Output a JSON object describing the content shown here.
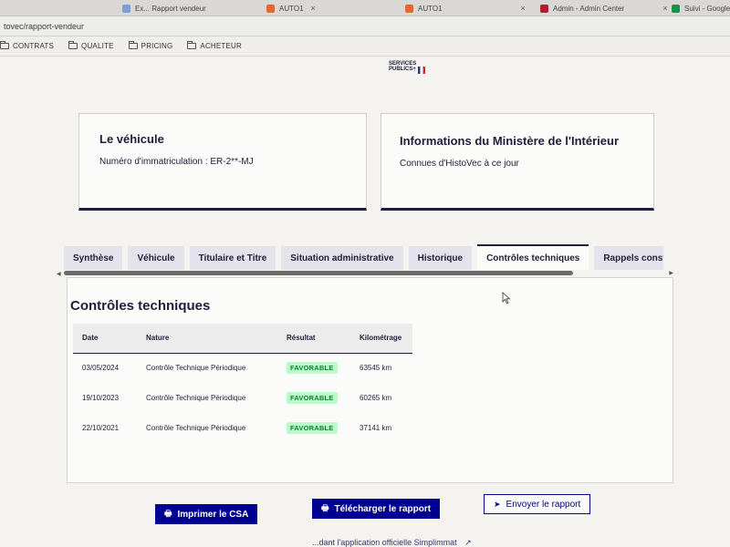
{
  "browser": {
    "tabs": [
      {
        "label": "Ex... Rapport vendeur",
        "icon": "tab-favicon"
      },
      {
        "label": "AUTO1",
        "icon": "auto1-favicon"
      },
      {
        "label": "AUTO1",
        "icon": "auto1-favicon"
      },
      {
        "label": "Admin - Admin Center",
        "icon": "admin-favicon"
      },
      {
        "label": "Suivi - Google S",
        "icon": "sheets-favicon"
      }
    ],
    "close_glyph": "×",
    "url": "tovec/rapport-vendeur",
    "bookmarks": [
      "CONTRATS",
      "QUALITE",
      "PRICING",
      "ACHETEUR"
    ]
  },
  "logo": {
    "line1": "SERVICES",
    "line2": "PUBLICS+"
  },
  "vehicle_card": {
    "title": "Le véhicule",
    "plate_label": "Numéro d'immatriculation : ER-2**-MJ"
  },
  "ministry_card": {
    "title": "Informations du Ministère de l'Intérieur",
    "subtitle": "Connues d'HistoVec à ce jour"
  },
  "tabs": [
    {
      "label": "Synthèse"
    },
    {
      "label": "Véhicule"
    },
    {
      "label": "Titulaire et Titre"
    },
    {
      "label": "Situation administrative"
    },
    {
      "label": "Historique"
    },
    {
      "label": "Contrôles techniques"
    },
    {
      "label": "Rappels constru"
    }
  ],
  "active_tab": "Contrôles techniques",
  "panel": {
    "title": "Contrôles techniques",
    "columns": [
      "Date",
      "Nature",
      "Résultat",
      "Kilométrage"
    ],
    "rows": [
      {
        "date": "03/05/2024",
        "nature": "Contrôle Technique Périodique",
        "result": "FAVORABLE",
        "km": "63545 km"
      },
      {
        "date": "19/10/2023",
        "nature": "Contrôle Technique Périodique",
        "result": "FAVORABLE",
        "km": "60265 km"
      },
      {
        "date": "22/10/2021",
        "nature": "Contrôle Technique Périodique",
        "result": "FAVORABLE",
        "km": "37141 km"
      }
    ]
  },
  "buttons": {
    "print": "Imprimer le CSA",
    "download": "Télécharger le rapport",
    "send": "Envoyer le rapport"
  },
  "footnote": "...dant l'application officielle Simplimmat",
  "colors": {
    "brand_blue": "#000091",
    "navy_text": "#1e1e3c",
    "success_bg": "#b8fec9",
    "success_text": "#18753c"
  }
}
